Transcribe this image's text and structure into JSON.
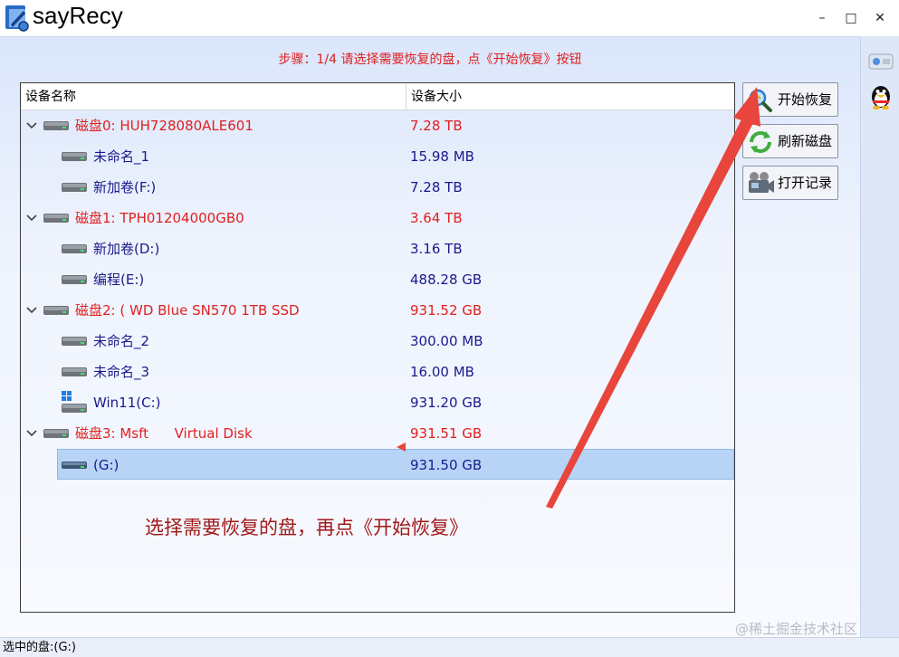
{
  "window": {
    "title": "sayRecy",
    "minimize": "–",
    "maximize": "□",
    "close": "✕"
  },
  "step_text": "步骤：1/4 请选择需要恢复的盘，点《开始恢复》按钮",
  "tree": {
    "columns": [
      "设备名称",
      "设备大小"
    ],
    "rows": [
      {
        "name": "磁盘0: HUH728080ALE601",
        "size": "7.28 TB"
      },
      {
        "name": "未命名_1",
        "size": "15.98 MB"
      },
      {
        "name": "新加卷(F:)",
        "size": "7.28 TB"
      },
      {
        "name": "磁盘1: TPH01204000GB0",
        "size": "3.64 TB"
      },
      {
        "name": "新加卷(D:)",
        "size": "3.16 TB"
      },
      {
        "name": "编程(E:)",
        "size": "488.28 GB"
      },
      {
        "name": "磁盘2: ( WD Blue SN570 1TB SSD",
        "size": "931.52 GB"
      },
      {
        "name": "未命名_2",
        "size": "300.00 MB"
      },
      {
        "name": "未命名_3",
        "size": "16.00 MB"
      },
      {
        "name": "Win11(C:)",
        "size": "931.20 GB"
      },
      {
        "name": "磁盘3: Msft      Virtual Disk",
        "size": "931.51 GB"
      },
      {
        "name": "(G:)",
        "size": "931.50 GB"
      }
    ]
  },
  "buttons": {
    "start": "开始恢复",
    "refresh": "刷新磁盘",
    "open_log": "打开记录"
  },
  "annotation": "选择需要恢复的盘，再点《开始恢复》",
  "status": "选中的盘:(G:)",
  "watermark": "@稀土掘金技术社区",
  "colors": {
    "disk_text": "#e02020",
    "partition_text": "#1a1a8c",
    "selection": "#b7d4f7",
    "arrow": "#e8453c"
  }
}
